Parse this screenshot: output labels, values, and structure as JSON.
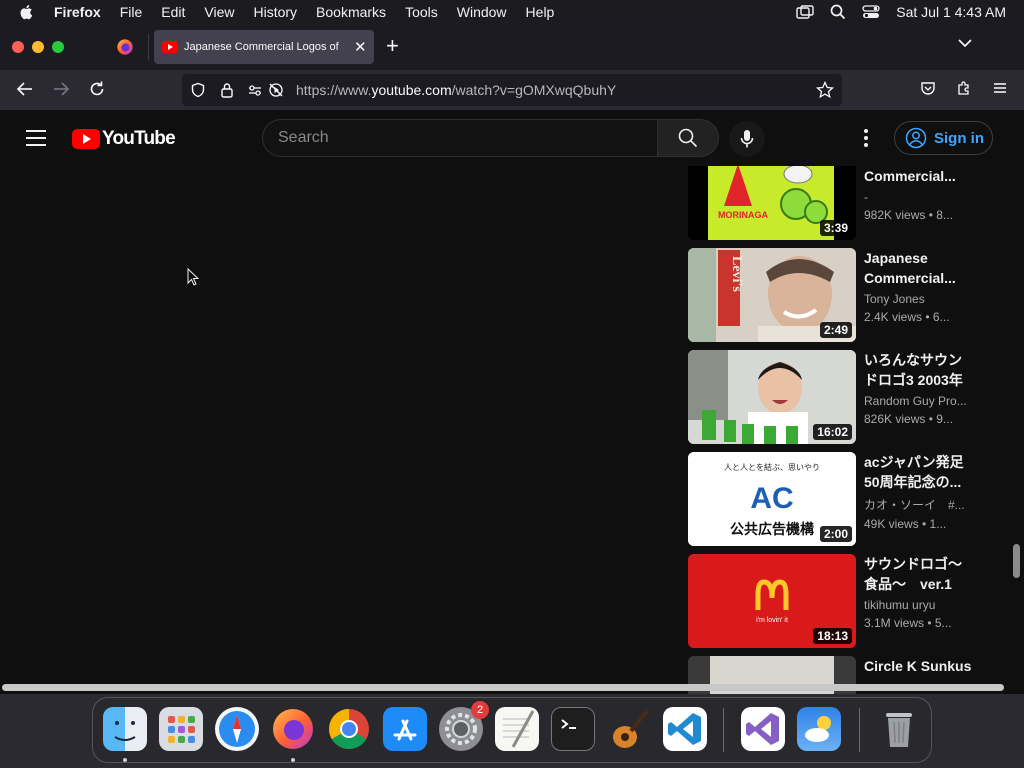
{
  "menubar": {
    "app_name": "Firefox",
    "items": [
      "File",
      "Edit",
      "View",
      "History",
      "Bookmarks",
      "Tools",
      "Window",
      "Help"
    ],
    "datetime": "Sat Jul 1  4:43 AM"
  },
  "browser": {
    "tab_title": "Japanese Commercial Logos of",
    "url_prefix": "https://www.",
    "url_domain": "youtube.com",
    "url_path": "/watch?v=gOMXwqQbuhY"
  },
  "youtube": {
    "logo_text": "YouTube",
    "search_placeholder": "Search",
    "sign_in_label": "Sign in",
    "related": [
      {
        "title": "Commercial...",
        "channel": "-",
        "stats": "982K views  • 8...",
        "duration": "3:39",
        "thumb": "morinaga"
      },
      {
        "title": "Japanese Commercial...",
        "channel": "Tony Jones",
        "stats": "2.4K views  • 6...",
        "duration": "2:49",
        "thumb": "levis"
      },
      {
        "title": "いろんなサウンドロゴ3 2003年",
        "channel": "Random Guy Pro...",
        "stats": "826K views  • 9...",
        "duration": "16:02",
        "thumb": "milo"
      },
      {
        "title": "acジャパン発足50周年記念の...",
        "channel": "カオ・ソーイ　#...",
        "stats": "49K views  • 1...",
        "duration": "2:00",
        "thumb": "ac"
      },
      {
        "title": "サウンドロゴ～食品～　ver.1",
        "channel": "tikihumu uryu",
        "stats": "3.1M views  • 5...",
        "duration": "18:13",
        "thumb": "mcdonalds"
      },
      {
        "title": "Circle K Sunkus",
        "channel": "",
        "stats": "",
        "duration": "",
        "thumb": "circlek"
      }
    ],
    "thumb_text": {
      "morinaga": "MORINAGA",
      "levis": "Levi's",
      "ac_top": "人と人とを結ぶ、思いやり",
      "ac_logo": "AC",
      "ac_bottom": "公共広告機構",
      "mcd_tag": "i'm lovin' it"
    }
  },
  "dock": {
    "apps": [
      "finder",
      "launchpad",
      "safari",
      "firefox",
      "chrome",
      "app-store",
      "system-settings",
      "textedit",
      "terminal",
      "garageband",
      "vscode",
      "visual-studio",
      "weather",
      "trash"
    ],
    "settings_badge": "2"
  },
  "colors": {
    "yt_red": "#ff0000",
    "yt_bg": "#0f0f0f",
    "signin_blue": "#3ea6ff",
    "mcd_red": "#da1a1a"
  }
}
